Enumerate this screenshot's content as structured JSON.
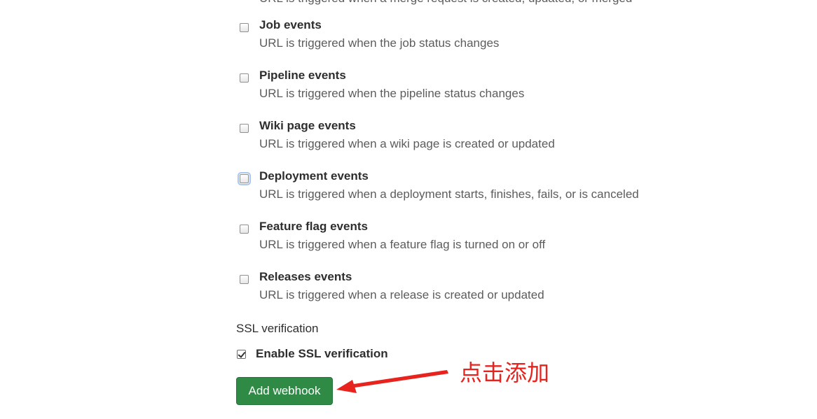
{
  "cutoff_text": "URL is triggered when a merge request is created, updated, or merged",
  "events": [
    {
      "title": "Job events",
      "help": "URL is triggered when the job status changes",
      "checked": false,
      "focused": false
    },
    {
      "title": "Pipeline events",
      "help": "URL is triggered when the pipeline status changes",
      "checked": false,
      "focused": false
    },
    {
      "title": "Wiki page events",
      "help": "URL is triggered when a wiki page is created or updated",
      "checked": false,
      "focused": false
    },
    {
      "title": "Deployment events",
      "help": "URL is triggered when a deployment starts, finishes, fails, or is canceled",
      "checked": false,
      "focused": true
    },
    {
      "title": "Feature flag events",
      "help": "URL is triggered when a feature flag is turned on or off",
      "checked": false,
      "focused": false
    },
    {
      "title": "Releases events",
      "help": "URL is triggered when a release is created or updated",
      "checked": false,
      "focused": false
    }
  ],
  "ssl": {
    "heading": "SSL verification",
    "label": "Enable SSL verification",
    "checked": true
  },
  "submit_label": "Add webhook",
  "annotation": {
    "text": "点击添加",
    "color": "#e8231e"
  },
  "colors": {
    "button_bg": "#2f8a46",
    "title_text": "#2e2e2e",
    "help_text": "#5c5c5c"
  }
}
